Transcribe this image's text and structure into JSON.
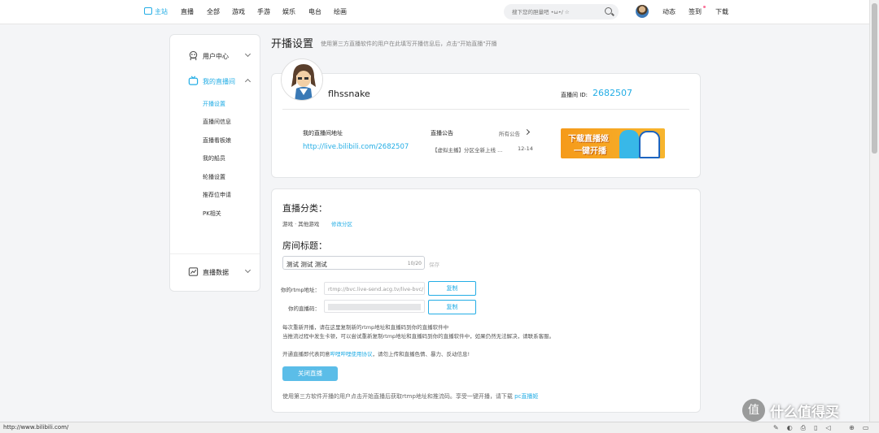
{
  "nav": {
    "home": "主站",
    "items": [
      "直播",
      "全部",
      "游戏",
      "手游",
      "娱乐",
      "电台",
      "绘画"
    ],
    "search_placeholder": "搜下您的胆量吧 •ω•/ ☆",
    "right": {
      "dynamic": "动态",
      "signin": "签到",
      "download": "下载"
    }
  },
  "sidebar": {
    "user_center": "用户中心",
    "my_room": "我的直播间",
    "sub_items": [
      "开播设置",
      "直播间信息",
      "直播看板娘",
      "我的船员",
      "轮播设置",
      "推荐位申请",
      "PK相关"
    ],
    "live_data": "直播数据"
  },
  "header": {
    "title": "开播设置",
    "desc": "使用第三方直播软件的用户在此填写开播信息后，点击\"开始直播\"开播"
  },
  "profile": {
    "username": "flhssnake",
    "room_id_label": "直播间 ID:",
    "room_id": "2682507",
    "addr_label": "我的直播间地址",
    "addr": "http://live.bilibili.com/2682507",
    "notice_label": "直播公告",
    "all_notice": "所有公告",
    "notice_item": "【虚拟主播】分区全新上线 ...",
    "notice_date": "12-14",
    "banner_line1": "下载直播姬",
    "banner_line2": "一键开播"
  },
  "settings": {
    "category_title": "直播分类：",
    "category": "游戏 · 其他游戏",
    "edit_category": "修改分区",
    "room_title_label": "房间标题：",
    "room_title": "测试 测试 测试",
    "title_count": "10/20",
    "save": "保存",
    "rtmp_label": "你的rtmp地址：",
    "rtmp_value": "rtmp://bvc.live-send.acg.tv/live-bvc/",
    "code_label": "你的直播码：",
    "copy": "复制",
    "tip1": "每次重新开播，请在这里复制新的rtmp地址和直播码到你的直播软件中",
    "tip2": "当推流过程中发生卡顿，可以尝试重新复制rtmp地址和直播码到你的直播软件中，如果仍然无法解决，请联系客服。",
    "tip3_pre": "开通直播即代表同意",
    "tip3_link": "哔哩哔哩使用协议",
    "tip3_post": "，请勿上传和直播色情、暴力、反动信息!",
    "close_btn": "关闭直播",
    "foot_pre": "使用第三方软件开播的用户点击开始直播后获取rtmp地址和推流码。享受一键开播，请下载 ",
    "foot_link": "pc直播姬"
  },
  "status": {
    "url": "http://www.bilibili.com/"
  },
  "watermark": {
    "circle": "值",
    "text": "什么值得买"
  }
}
